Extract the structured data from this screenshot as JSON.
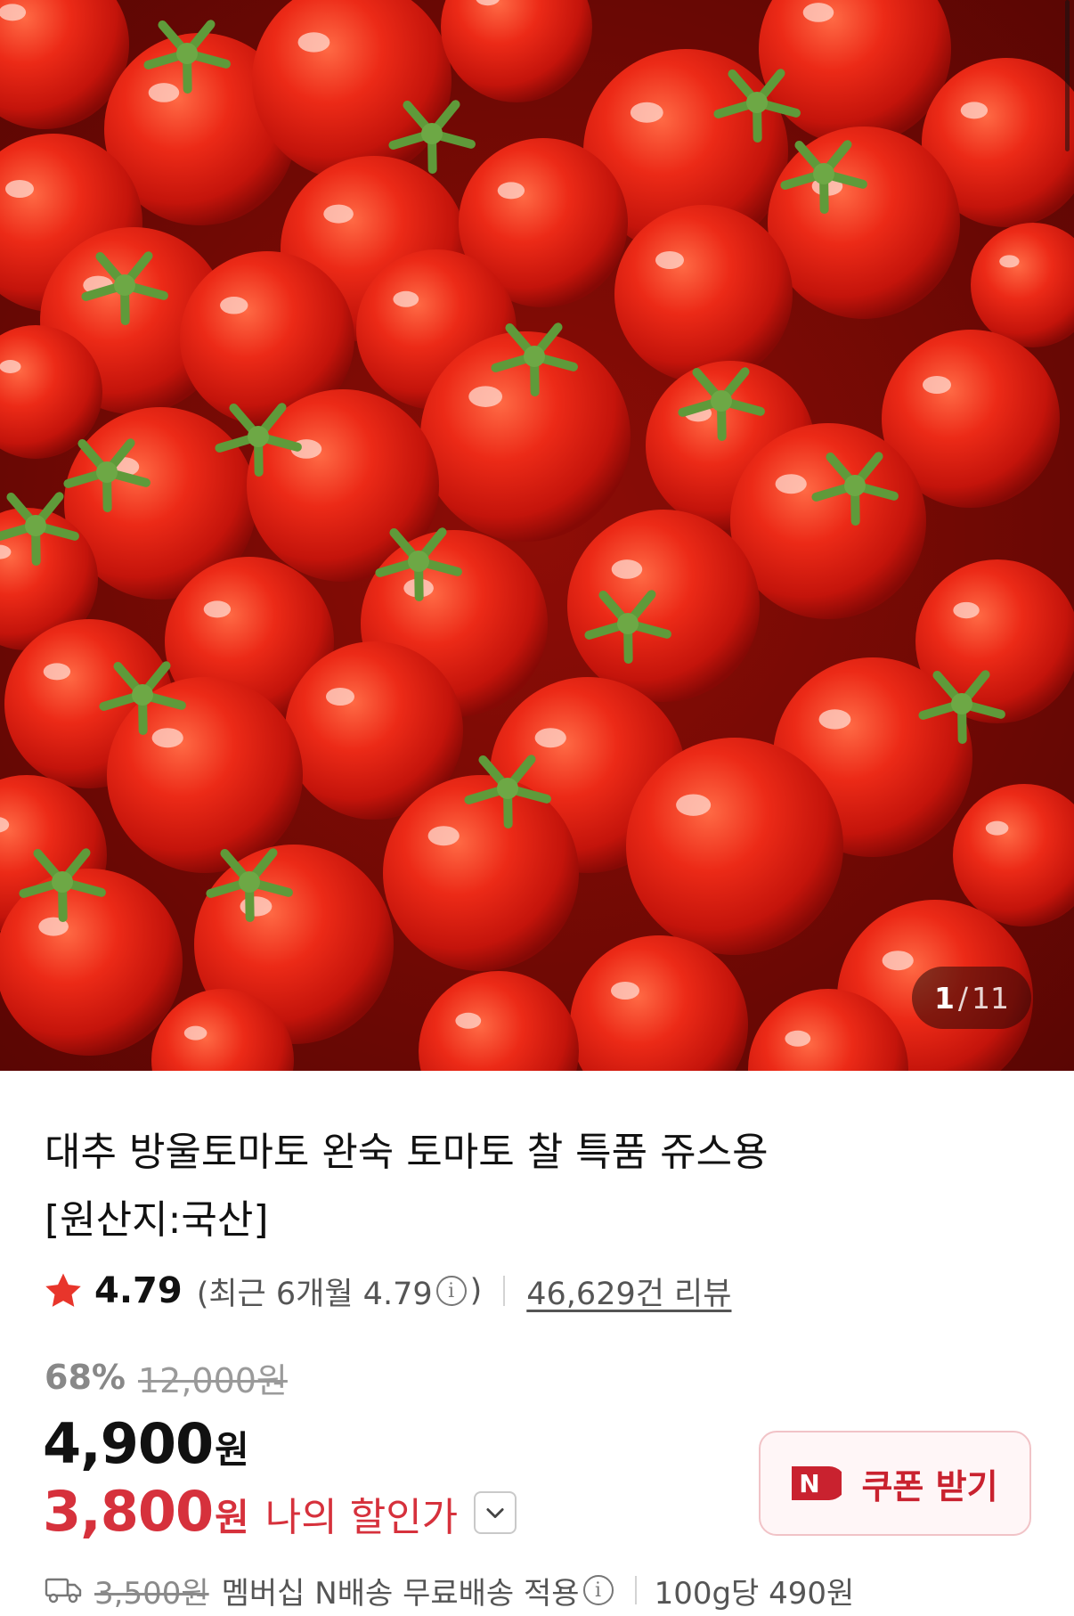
{
  "gallery": {
    "image_alt": "cherry tomatoes",
    "counter_current": "1",
    "counter_separator": "/",
    "counter_total": "11"
  },
  "product": {
    "title_line1": "대추 방울토마토 완숙 토마토 찰 특품 쥬스용",
    "title_line2": "[원산지:국산]"
  },
  "rating": {
    "score": "4.79",
    "recent_open": "(최근 6개월 4.79",
    "recent_close": ")",
    "review_count": "46,629건 리뷰"
  },
  "price": {
    "discount_rate": "68%",
    "original_price": "12,000원",
    "sale_price": "4,900",
    "sale_unit": "원",
    "my_price": "3,800",
    "my_unit": "원",
    "my_price_label": "나의 할인가"
  },
  "coupon": {
    "badge": "N",
    "label": "쿠폰 받기"
  },
  "shipping": {
    "original_fee": "3,500원",
    "description": "멤버십 N배송 무료배송 적용",
    "unit_price": "100g당 490원"
  },
  "colors": {
    "accent_red": "#d6313c",
    "naver_badge": "#c9222f",
    "coupon_border": "#f1c3c7"
  }
}
